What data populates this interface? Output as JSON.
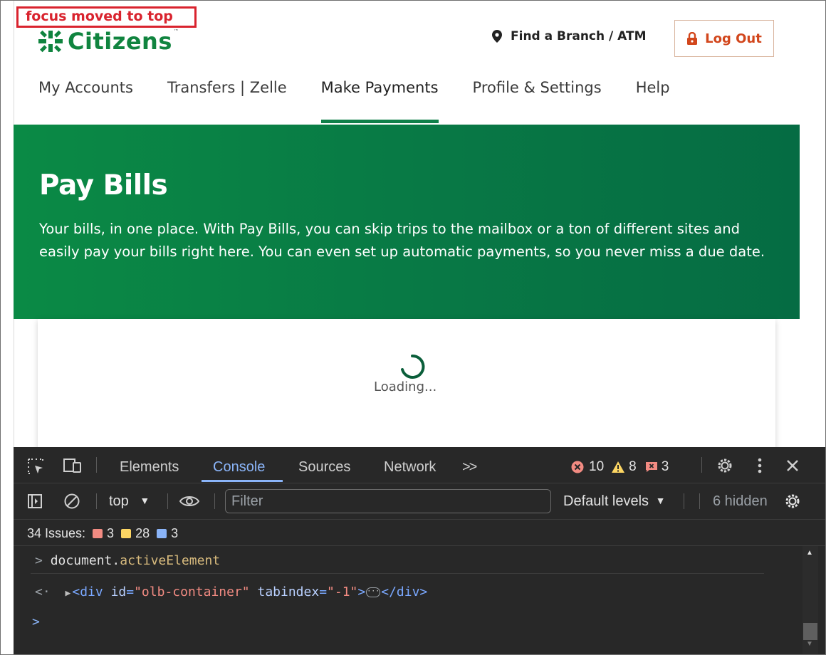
{
  "annotation": {
    "text": "focus moved to top"
  },
  "header": {
    "logo_text": "Citizens",
    "logo_tm": "™",
    "find_branch": "Find a Branch / ATM",
    "logout": "Log Out"
  },
  "nav": {
    "items": [
      {
        "label": "My Accounts"
      },
      {
        "label": "Transfers | Zelle"
      },
      {
        "label": "Make Payments",
        "active": true
      },
      {
        "label": "Profile & Settings"
      },
      {
        "label": "Help"
      }
    ]
  },
  "hero": {
    "title": "Pay Bills",
    "description": "Your bills, in one place. With Pay Bills, you can skip trips to the mailbox or a ton of different sites and easily pay your bills right here. You can even set up automatic payments, so you never miss a due date."
  },
  "loading": {
    "text": "Loading..."
  },
  "devtools": {
    "tabs": [
      "Elements",
      "Console",
      "Sources",
      "Network"
    ],
    "more": ">>",
    "errors": "10",
    "warnings": "8",
    "issues_count": "3",
    "context": "top",
    "filter_placeholder": "Filter",
    "levels": "Default levels",
    "hidden": "6 hidden",
    "issues_bar": {
      "label": "34 Issues:",
      "error_count": "3",
      "warning_count": "28",
      "info_count": "3"
    },
    "console": {
      "input_prompt": ">",
      "input_obj": "document.",
      "input_prop": "activeElement",
      "output_prefix": "<·",
      "output_tag_open": "<div",
      "output_attr1": "id",
      "output_val1": "\"olb-container\"",
      "output_attr2": "tabindex",
      "output_val2": "\"-1\"",
      "output_tag_close": "</div>",
      "prompt": ">"
    }
  },
  "colors": {
    "brand_green": "#10843f",
    "logout_orange": "#d2461c",
    "annotation_red": "#d9232e"
  }
}
